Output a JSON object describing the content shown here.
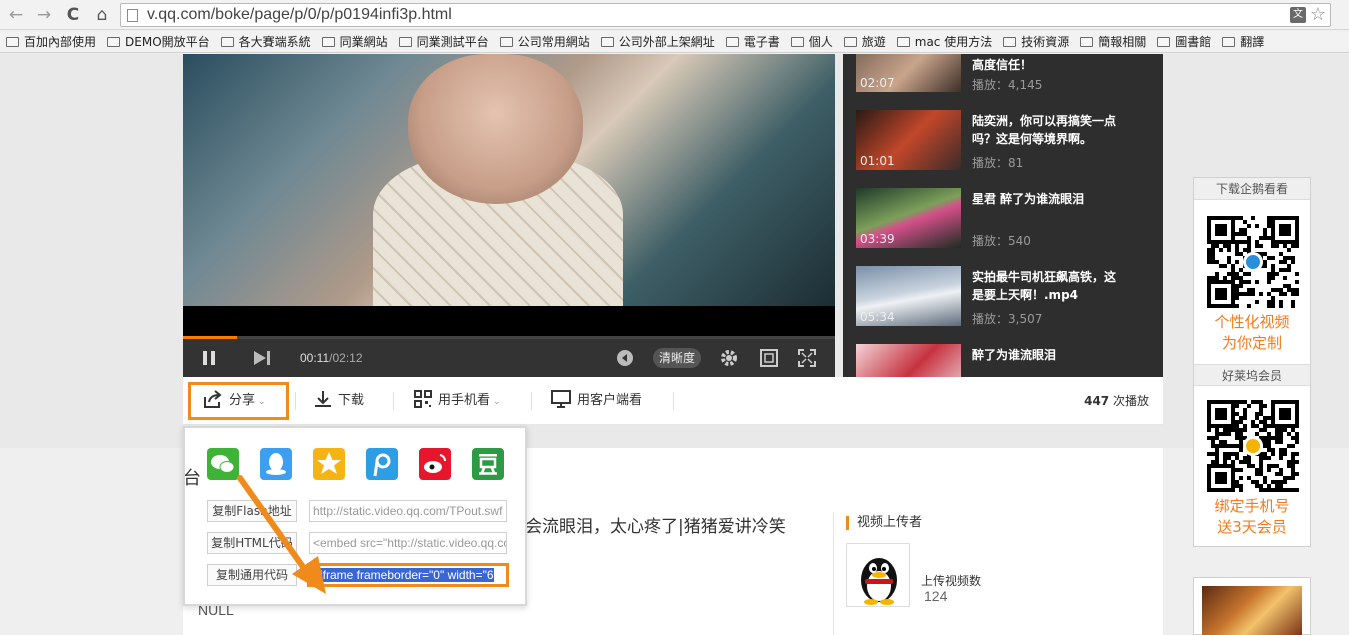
{
  "browser": {
    "url_text": "v.qq.com/boke/page/p/0/p/p0194infi3p.html",
    "translate_glyph": "文",
    "nav": {
      "back": "←",
      "forward": "→",
      "reload": "C",
      "home": "⌂",
      "star": "☆"
    }
  },
  "bookmarks": [
    "百加內部使用",
    "DEMO開放平台",
    "各大賽端系統",
    "同業網站",
    "同業測試平台",
    "公司常用網站",
    "公司外部上架網址",
    "電子書",
    "個人",
    "旅遊",
    "mac 使用方法",
    "技術資源",
    "簡報相關",
    "圖書館",
    "翻譯"
  ],
  "player": {
    "time_current": "00:11",
    "time_sep": "/",
    "time_duration": "02:12",
    "quality_label": "清晰度",
    "progress_fraction": 0.083
  },
  "playlist": [
    {
      "title": "高度信任！",
      "plays": "播放：4,145",
      "duration": "02:07"
    },
    {
      "title": "陆奕洲，你可以再搞笑一点吗？这是何等境界啊。",
      "plays": "播放：81",
      "duration": "01:01"
    },
    {
      "title": "星君 醉了为谁流眼泪",
      "plays": "播放：540",
      "duration": "03:39"
    },
    {
      "title": "实拍最牛司机狂飙高铁，这是要上天啊！.mp4",
      "plays": "播放：3,507",
      "duration": "05:34"
    },
    {
      "title": "醉了为谁流眼泪",
      "plays": "",
      "duration": ""
    }
  ],
  "toolbar": {
    "share": "分享",
    "download": "下载",
    "mobile": "用手机看",
    "client": "用客户端看",
    "plays_count": "447",
    "plays_suffix": "次播放"
  },
  "share_popup": {
    "social": [
      {
        "name": "wechat",
        "color": "#3fb338"
      },
      {
        "name": "qq",
        "color": "#3c9ff0"
      },
      {
        "name": "qzone",
        "color": "#f5b314"
      },
      {
        "name": "tencent-weibo",
        "color": "#2e9ee4"
      },
      {
        "name": "sina-weibo",
        "color": "#e6162d"
      },
      {
        "name": "douban",
        "color": "#2d9a44"
      }
    ],
    "flash_label": "复制Flash地址",
    "flash_value": "http://static.video.qq.com/TPout.swf",
    "html_label": "复制HTML代码",
    "html_value": "<embed src=\"http://static.video.qq.com",
    "iframe_label": "复制通用代码",
    "iframe_value": "<iframe frameborder=\"0\" width=\"6"
  },
  "content": {
    "title_partial": "会流眼泪，太心疼了|猪猪爱讲冷笑",
    "description": "NULL",
    "heading_char": "台"
  },
  "uploader": {
    "section_title": "视频上传者",
    "videos_label": "上传视频数",
    "videos_count": "124"
  },
  "side_panel": {
    "download_title": "下载企鹅看看",
    "download_text_1": "个性化视频",
    "download_text_2": "为你定制",
    "member_title": "好莱坞会员",
    "member_text_1": "绑定手机号",
    "member_text_2": "送3天会员"
  },
  "colors": {
    "accent": "#f08a1b",
    "selection": "#3a66d4",
    "side_text": "#f07c1b"
  }
}
